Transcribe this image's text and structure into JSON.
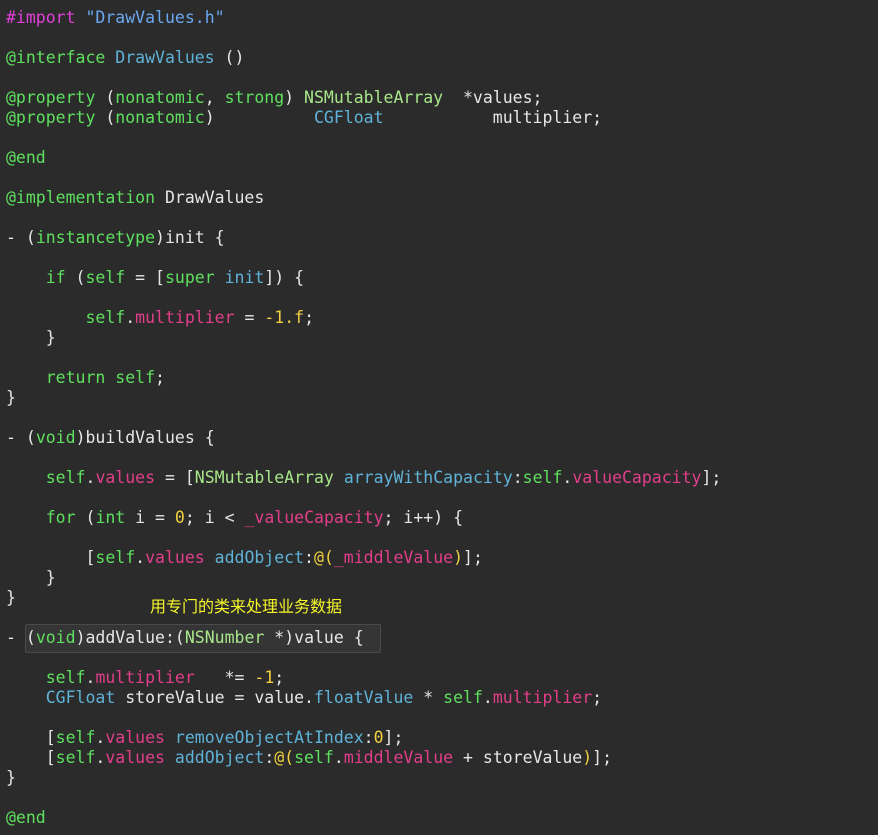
{
  "annotation": "用专门的类来处理业务数据",
  "lines": [
    [
      [
        "pre",
        "#import "
      ],
      [
        "str",
        "\"DrawValues.h\""
      ]
    ],
    [
      [
        "kw",
        "@interface "
      ],
      [
        "meth",
        "DrawValues"
      ],
      [
        "pl",
        " ()"
      ]
    ],
    [
      [
        "kw",
        "@property "
      ],
      [
        "pl",
        "("
      ],
      [
        "kw",
        "nonatomic"
      ],
      [
        "pl",
        ", "
      ],
      [
        "kw",
        "strong"
      ],
      [
        "pl",
        ") "
      ],
      [
        "cls",
        "NSMutableArray"
      ],
      [
        "pl",
        "  *values;"
      ]
    ],
    [
      [
        "kw",
        "@property "
      ],
      [
        "pl",
        "("
      ],
      [
        "kw",
        "nonatomic"
      ],
      [
        "pl",
        ")          "
      ],
      [
        "meth",
        "CGFloat"
      ],
      [
        "pl",
        "           multiplier;"
      ]
    ],
    [
      [
        "kw",
        "@end"
      ]
    ],
    [
      [
        "kw",
        "@implementation "
      ],
      [
        "pl",
        "DrawValues"
      ]
    ],
    [
      [
        "pl",
        "- ("
      ],
      [
        "kw",
        "instancetype"
      ],
      [
        "pl",
        ")init {"
      ]
    ],
    [
      [
        "pl",
        "    "
      ],
      [
        "kw",
        "if"
      ],
      [
        "pl",
        " ("
      ],
      [
        "kw",
        "self"
      ],
      [
        "pl",
        " = ["
      ],
      [
        "kw",
        "super"
      ],
      [
        "pl",
        " "
      ],
      [
        "meth",
        "init"
      ],
      [
        "pl",
        "]) {"
      ]
    ],
    [
      [
        "pl",
        "        "
      ],
      [
        "kw",
        "self"
      ],
      [
        "pl",
        "."
      ],
      [
        "prop",
        "multiplier"
      ],
      [
        "pl",
        " = "
      ],
      [
        "num",
        "-1.f"
      ],
      [
        "pl",
        ";"
      ]
    ],
    [
      [
        "pl",
        "    }"
      ]
    ],
    [
      [
        "pl",
        "    "
      ],
      [
        "kw",
        "return"
      ],
      [
        "pl",
        " "
      ],
      [
        "kw",
        "self"
      ],
      [
        "pl",
        ";"
      ]
    ],
    [
      [
        "pl",
        "}"
      ]
    ],
    [
      [
        "pl",
        "- ("
      ],
      [
        "kw",
        "void"
      ],
      [
        "pl",
        ")buildValues {"
      ]
    ],
    [
      [
        "pl",
        "    "
      ],
      [
        "kw",
        "self"
      ],
      [
        "pl",
        "."
      ],
      [
        "prop",
        "values"
      ],
      [
        "pl",
        " = ["
      ],
      [
        "cls",
        "NSMutableArray"
      ],
      [
        "pl",
        " "
      ],
      [
        "meth",
        "arrayWithCapacity"
      ],
      [
        "pl",
        ":"
      ],
      [
        "kw",
        "self"
      ],
      [
        "pl",
        "."
      ],
      [
        "prop",
        "valueCapacity"
      ],
      [
        "pl",
        "];"
      ]
    ],
    [
      [
        "pl",
        "    "
      ],
      [
        "kw",
        "for"
      ],
      [
        "pl",
        " ("
      ],
      [
        "kw",
        "int"
      ],
      [
        "pl",
        " i = "
      ],
      [
        "num",
        "0"
      ],
      [
        "pl",
        "; i < "
      ],
      [
        "prop",
        "_valueCapacity"
      ],
      [
        "pl",
        "; i++) {"
      ]
    ],
    [
      [
        "pl",
        "        ["
      ],
      [
        "kw",
        "self"
      ],
      [
        "pl",
        "."
      ],
      [
        "prop",
        "values"
      ],
      [
        "pl",
        " "
      ],
      [
        "meth",
        "addObject"
      ],
      [
        "pl",
        ":"
      ],
      [
        "num",
        "@("
      ],
      [
        "prop",
        "_middleValue"
      ],
      [
        "num",
        ")"
      ],
      [
        "pl",
        "];"
      ]
    ],
    [
      [
        "pl",
        "    }"
      ]
    ],
    [
      [
        "pl",
        "}"
      ]
    ],
    [
      [
        "pl",
        "- ("
      ],
      [
        "kw",
        "void"
      ],
      [
        "pl",
        ")addValue:("
      ],
      [
        "cls",
        "NSNumber"
      ],
      [
        "pl",
        " *)value {"
      ]
    ],
    [
      [
        "pl",
        "    "
      ],
      [
        "kw",
        "self"
      ],
      [
        "pl",
        "."
      ],
      [
        "prop",
        "multiplier"
      ],
      [
        "pl",
        "   *= "
      ],
      [
        "num",
        "-1"
      ],
      [
        "pl",
        ";"
      ]
    ],
    [
      [
        "pl",
        "    "
      ],
      [
        "meth",
        "CGFloat"
      ],
      [
        "pl",
        " storeValue = value."
      ],
      [
        "meth",
        "floatValue"
      ],
      [
        "pl",
        " * "
      ],
      [
        "kw",
        "self"
      ],
      [
        "pl",
        "."
      ],
      [
        "prop",
        "multiplier"
      ],
      [
        "pl",
        ";"
      ]
    ],
    [
      [
        "pl",
        "    ["
      ],
      [
        "kw",
        "self"
      ],
      [
        "pl",
        "."
      ],
      [
        "prop",
        "values"
      ],
      [
        "pl",
        " "
      ],
      [
        "meth",
        "removeObjectAtIndex"
      ],
      [
        "pl",
        ":"
      ],
      [
        "num",
        "0"
      ],
      [
        "pl",
        "];"
      ]
    ],
    [
      [
        "pl",
        "    ["
      ],
      [
        "kw",
        "self"
      ],
      [
        "pl",
        "."
      ],
      [
        "prop",
        "values"
      ],
      [
        "pl",
        " "
      ],
      [
        "meth",
        "addObject"
      ],
      [
        "pl",
        ":"
      ],
      [
        "num",
        "@("
      ],
      [
        "kw",
        "self"
      ],
      [
        "pl",
        "."
      ],
      [
        "prop",
        "middleValue"
      ],
      [
        "pl",
        " + storeValue"
      ],
      [
        "num",
        ")"
      ],
      [
        "pl",
        "];"
      ]
    ],
    [
      [
        "pl",
        "}"
      ]
    ],
    [
      [
        "kw",
        "@end"
      ]
    ]
  ]
}
